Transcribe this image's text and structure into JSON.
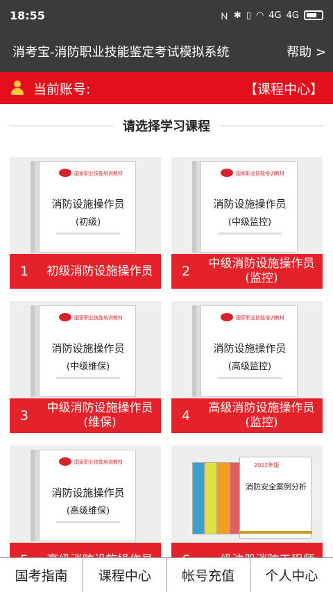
{
  "status": {
    "time": "18:55",
    "icons": [
      "nfc-icon",
      "bluetooth-muted-icon",
      "vibrate-icon",
      "wifi-icon",
      "signal-icon",
      "signal-icon",
      "battery-icon"
    ],
    "signal1": "4G",
    "signal2": "4G"
  },
  "header": {
    "title": "消考宝-消防职业技能鉴定考试模拟系统",
    "help": "帮助 >"
  },
  "account": {
    "label": "当前账号:",
    "center_link": "【课程中心】"
  },
  "section": {
    "title": "请选择学习课程"
  },
  "courses": [
    {
      "num": "1",
      "name": "初级消防设施操作员",
      "book_title": "消防设施操作员",
      "book_level": "(初级)"
    },
    {
      "num": "2",
      "name": "中级消防设施操作员(监控)",
      "book_title": "消防设施操作员",
      "book_level": "(中级监控)"
    },
    {
      "num": "3",
      "name": "中级消防设施操作员(维保)",
      "book_title": "消防设施操作员",
      "book_level": "(中级维保)"
    },
    {
      "num": "4",
      "name": "高级消防设施操作员(监控)",
      "book_title": "消防设施操作员",
      "book_level": "(高级监控)"
    },
    {
      "num": "5",
      "name": "高级消防设施操作员",
      "book_title": "消防设施操作员",
      "book_level": "(高级维保)"
    },
    {
      "num": "6",
      "name": "一级注册消防工程师",
      "book_title": "消防安全案例分析",
      "book_year": "2022年版"
    }
  ],
  "book_series": "国家职业技能培训教材",
  "nav": [
    "国考指南",
    "课程中心",
    "帐号充值",
    "个人中心"
  ],
  "colors": {
    "header": "#3b3b3b",
    "accent": "#e3101b"
  }
}
